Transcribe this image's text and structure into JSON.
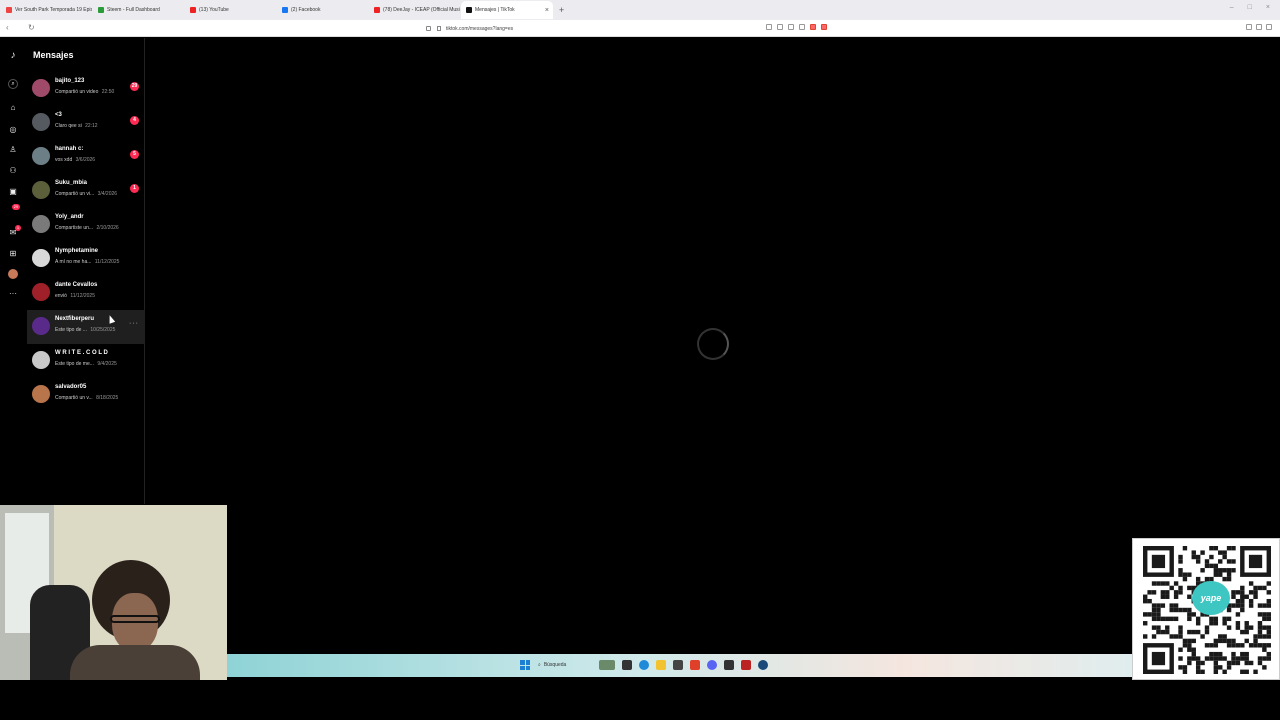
{
  "browser": {
    "tabs": [
      {
        "label": "Ver South Park Temporada 19 Episo",
        "color": "#e44"
      },
      {
        "label": "Steem - Full Dashboard",
        "color": "#2a9d3a"
      },
      {
        "label": "(13) YouTube",
        "color": "#e22"
      },
      {
        "label": "(2) Facebook",
        "color": "#1877f2"
      },
      {
        "label": "(78) DeeJay - ICEAP (Official Music",
        "color": "#e22"
      },
      {
        "label": "Mensajes | TikTok",
        "color": "#111"
      }
    ],
    "active_tab_index": 5,
    "url": "tiktok.com/messages?lang=es"
  },
  "tiktok": {
    "panel_title": "Mensajes",
    "rail_badges": [
      "29",
      "1"
    ],
    "conversations": [
      {
        "name": "bajito_123",
        "preview": "Compartió un video",
        "time": "22:50",
        "badge": "29",
        "avatar": "#a04a6a"
      },
      {
        "name": "<3",
        "preview": "Claro qee si",
        "time": "22:12",
        "badge": "4",
        "avatar": "#555a60"
      },
      {
        "name": "hannah c:",
        "preview": "vos xdd",
        "time": "3/6/2026",
        "badge": "5",
        "avatar": "#6d7f86"
      },
      {
        "name": "Suku_mbia",
        "preview": "Compartió un vi...",
        "time": "3/4/2026",
        "badge": "1",
        "avatar": "#5b5f3a"
      },
      {
        "name": "Yoly_andr",
        "preview": "Compartiste un...",
        "time": "2/10/2026",
        "badge": "",
        "avatar": "#7a7a7a"
      },
      {
        "name": "Nymphetamine",
        "preview": "A mí no me ha...",
        "time": "11/12/2025",
        "badge": "",
        "avatar": "#d8d8d8"
      },
      {
        "name": "dante Cevallos",
        "preview": "envió",
        "time": "11/12/2025",
        "badge": "",
        "avatar": "#a0202a"
      },
      {
        "name": "Nextfiberperu",
        "preview": "Este tipo de ...",
        "time": "10/25/2025",
        "badge": "",
        "avatar": "#5a2a8a"
      },
      {
        "name": "W R I T E . C O L D",
        "preview": "Este tipo de me...",
        "time": "9/4/2025",
        "badge": "",
        "avatar": "#c8c8c8"
      },
      {
        "name": "salvador05",
        "preview": "Compartió un v...",
        "time": "8/18/2025",
        "badge": "",
        "avatar": "#b8744a"
      }
    ],
    "hovered_index": 7
  },
  "taskbar": {
    "search_placeholder": "Búsqueda"
  },
  "qr": {
    "brand": "yape"
  }
}
